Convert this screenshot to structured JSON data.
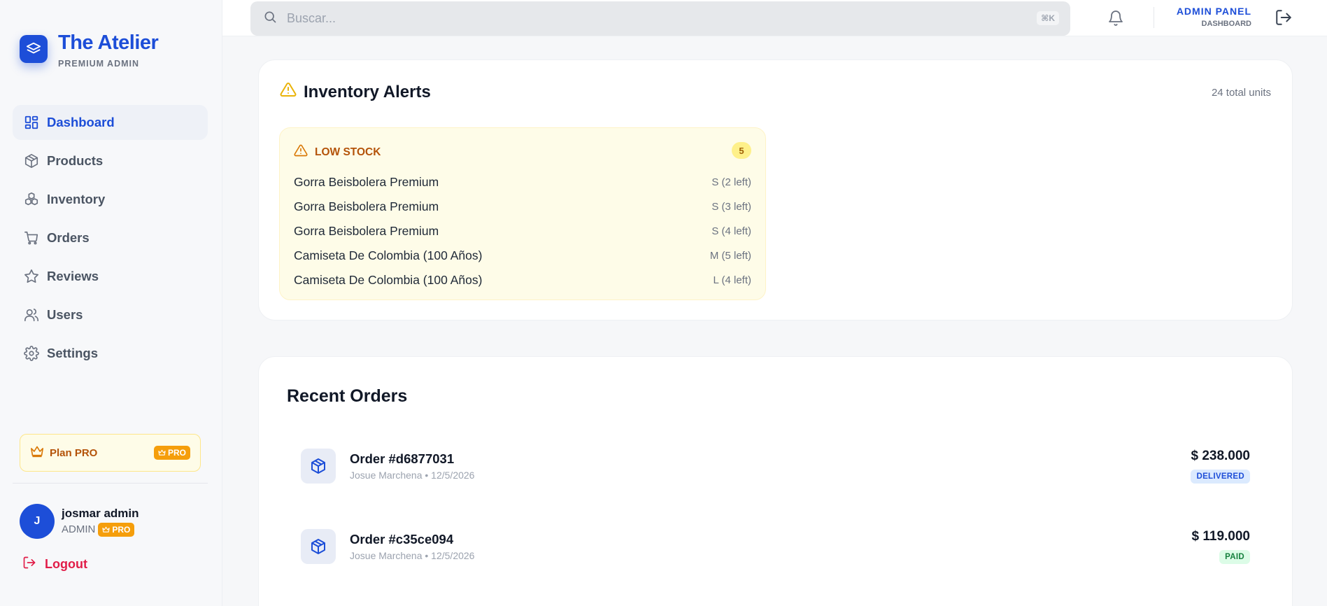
{
  "brand": {
    "title": "The Atelier",
    "subtitle": "PREMIUM ADMIN"
  },
  "nav": {
    "items": [
      {
        "label": "Dashboard",
        "icon": "dashboard-icon",
        "active": true
      },
      {
        "label": "Products",
        "icon": "box-icon"
      },
      {
        "label": "Inventory",
        "icon": "boxes-icon"
      },
      {
        "label": "Orders",
        "icon": "cart-icon"
      },
      {
        "label": "Reviews",
        "icon": "star-icon"
      },
      {
        "label": "Users",
        "icon": "users-icon"
      },
      {
        "label": "Settings",
        "icon": "gear-icon"
      }
    ]
  },
  "plan": {
    "label": "Plan PRO",
    "badge": "PRO"
  },
  "user": {
    "initial": "J",
    "name": "josmar admin",
    "role": "ADMIN",
    "badge": "PRO"
  },
  "logout": {
    "label": "Logout"
  },
  "header": {
    "search_placeholder": "Buscar...",
    "shortcut": "⌘K",
    "panel_title": "ADMIN PANEL",
    "panel_sub": "DASHBOARD"
  },
  "alerts": {
    "title": "Inventory Alerts",
    "total": "24 total units",
    "low_stock": {
      "title": "LOW STOCK",
      "count": "5",
      "items": [
        {
          "name": "Gorra Beisbolera Premium",
          "size": "S (2 left)"
        },
        {
          "name": "Gorra Beisbolera Premium",
          "size": "S (3 left)"
        },
        {
          "name": "Gorra Beisbolera Premium",
          "size": "S (4 left)"
        },
        {
          "name": "Camiseta De Colombia (100 Años)",
          "size": "M (5 left)"
        },
        {
          "name": "Camiseta De Colombia (100 Años)",
          "size": "L (4 left)"
        }
      ]
    }
  },
  "orders": {
    "title": "Recent Orders",
    "items": [
      {
        "id": "Order #d6877031",
        "meta": "Josue Marchena • 12/5/2026",
        "amount": "$ 238.000",
        "status": "DELIVERED"
      },
      {
        "id": "Order #c35ce094",
        "meta": "Josue Marchena • 12/5/2026",
        "amount": "$ 119.000",
        "status": "PAID"
      }
    ]
  },
  "colors": {
    "accent": "#1d4ed8",
    "warning": "#b45309",
    "danger": "#e11d48",
    "success": "#15803d"
  }
}
